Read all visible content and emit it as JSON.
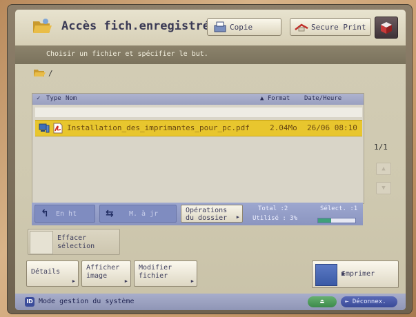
{
  "header": {
    "title": "Accès fich.enregistrés",
    "copy_label": "Copie",
    "secure_print_label": "Secure Print"
  },
  "instruction": "Choisir un fichier et spécifier le but.",
  "path": "/",
  "list": {
    "columns": {
      "type": "Type",
      "name": "Nom",
      "format": "▲ Format",
      "date": "Date/Heure"
    },
    "rows": [
      {
        "name": "Installation_des_imprimantes_pour_pc.pdf",
        "size": "2.04Mo",
        "date": "26/06  08:10",
        "selected": true
      }
    ]
  },
  "pager": "1/1",
  "actions": {
    "up_label": "En ht",
    "update_label": "M. à jr",
    "folder_ops_line1": "Opérations",
    "folder_ops_line2": "du dossier",
    "total": "Total :2",
    "used": "Utilisé : 3%",
    "selected_count": "Sélect. :1",
    "usage_fraction": 0.35
  },
  "clear_selection": {
    "line1": "Effacer",
    "line2": "sélection"
  },
  "bottom_buttons": {
    "details": "Détails",
    "show_image_1": "Afficher",
    "show_image_2": "image",
    "edit_file_1": "Modifier",
    "edit_file_2": "fichier",
    "print": "Imprimer"
  },
  "status": {
    "mode": "Mode gestion du système",
    "logout": "Déconnex."
  },
  "colors": {
    "selected_row": "#e8c62e",
    "list_header": "#9aa0c0",
    "instruction_bar": "#7a725c"
  }
}
